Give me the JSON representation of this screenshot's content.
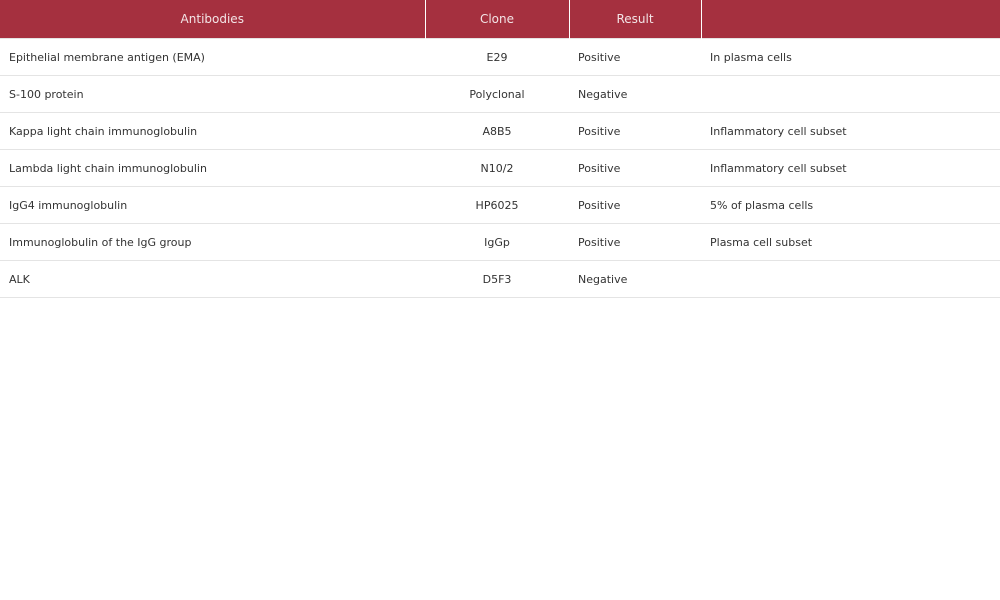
{
  "table": {
    "headers": [
      "Antibodies",
      "Clone",
      "Result",
      ""
    ],
    "rows": [
      {
        "antibody": "Epithelial membrane antigen (EMA)",
        "clone": "E29",
        "result": "Positive",
        "note": "In plasma cells"
      },
      {
        "antibody": "S-100 protein",
        "clone": "Polyclonal",
        "result": "Negative",
        "note": ""
      },
      {
        "antibody": "Kappa light chain immunoglobulin",
        "clone": "A8B5",
        "result": "Positive",
        "note": "Inflammatory cell subset"
      },
      {
        "antibody": "Lambda light chain immunoglobulin",
        "clone": "N10/2",
        "result": "Positive",
        "note": "Inflammatory cell subset"
      },
      {
        "antibody": "IgG4 immunoglobulin",
        "clone": "HP6025",
        "result": "Positive",
        "note": "5% of plasma cells"
      },
      {
        "antibody": "Immunoglobulin of the IgG group",
        "clone": "IgGp",
        "result": "Positive",
        "note": "Plasma cell subset"
      },
      {
        "antibody": "ALK",
        "clone": "D5F3",
        "result": "Negative",
        "note": ""
      }
    ]
  },
  "colors": {
    "header_background": "#a5303f",
    "header_text": "#f3e4e6",
    "row_divider": "#e4e4e4"
  }
}
